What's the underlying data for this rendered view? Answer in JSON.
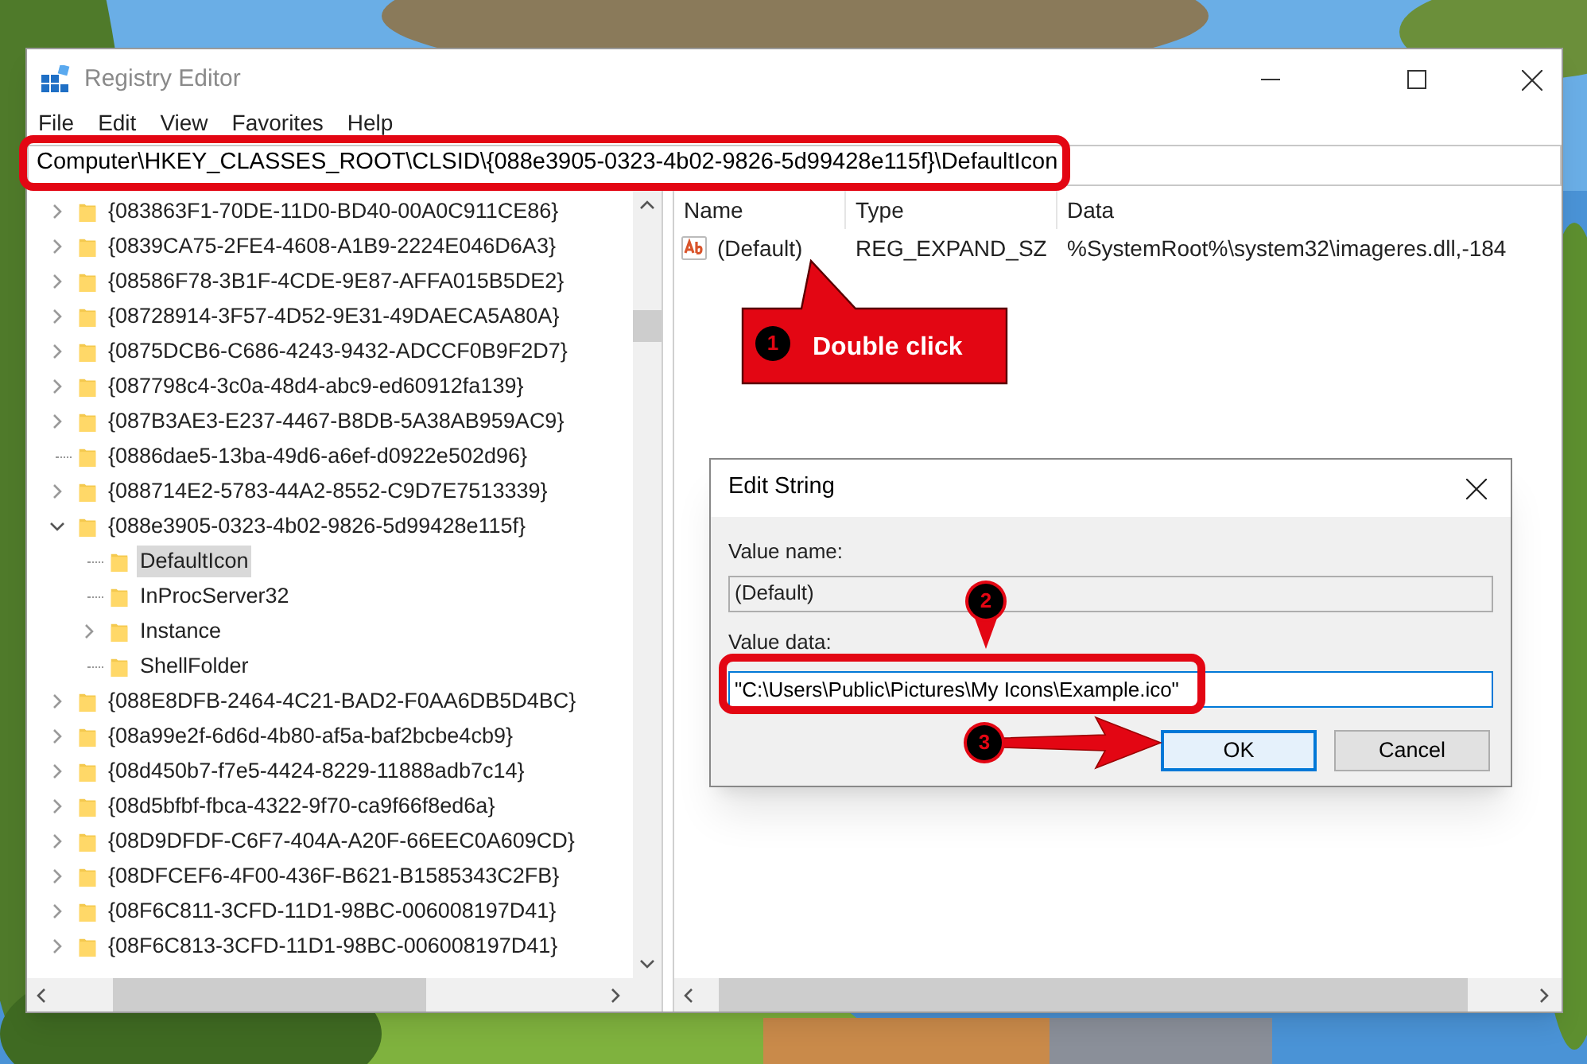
{
  "window": {
    "title": "Registry Editor"
  },
  "menu": [
    "File",
    "Edit",
    "View",
    "Favorites",
    "Help"
  ],
  "address_bar": {
    "value": "Computer\\HKEY_CLASSES_ROOT\\CLSID\\{088e3905-0323-4b02-9826-5d99428e115f}\\DefaultIcon",
    "highlighted": true
  },
  "tree": [
    {
      "label": "{083863F1-70DE-11D0-BD40-00A0C911CE86}",
      "kind": "collapsed",
      "selected": false
    },
    {
      "label": "{0839CA75-2FE4-4608-A1B9-2224E046D6A3}",
      "kind": "collapsed",
      "selected": false
    },
    {
      "label": "{08586F78-3B1F-4CDE-9E87-AFFA015B5DE2}",
      "kind": "collapsed",
      "selected": false
    },
    {
      "label": "{08728914-3F57-4D52-9E31-49DAECA5A80A}",
      "kind": "collapsed",
      "selected": false
    },
    {
      "label": "{0875DCB6-C686-4243-9432-ADCCF0B9F2D7}",
      "kind": "collapsed",
      "selected": false
    },
    {
      "label": "{087798c4-3c0a-48d4-abc9-ed60912fa139}",
      "kind": "collapsed",
      "selected": false
    },
    {
      "label": "{087B3AE3-E237-4467-B8DB-5A38AB959AC9}",
      "kind": "collapsed",
      "selected": false
    },
    {
      "label": "{0886dae5-13ba-49d6-a6ef-d0922e502d96}",
      "kind": "leaf",
      "selected": false
    },
    {
      "label": "{088714E2-5783-44A2-8552-C9D7E7513339}",
      "kind": "collapsed",
      "selected": false
    },
    {
      "label": "{088e3905-0323-4b02-9826-5d99428e115f}",
      "kind": "expanded",
      "selected": false,
      "children": [
        {
          "label": "DefaultIcon",
          "kind": "leaf",
          "selected": true
        },
        {
          "label": "InProcServer32",
          "kind": "leaf",
          "selected": false
        },
        {
          "label": "Instance",
          "kind": "collapsed",
          "selected": false
        },
        {
          "label": "ShellFolder",
          "kind": "leaf",
          "selected": false
        }
      ]
    },
    {
      "label": "{088E8DFB-2464-4C21-BAD2-F0AA6DB5D4BC}",
      "kind": "collapsed",
      "selected": false
    },
    {
      "label": "{08a99e2f-6d6d-4b80-af5a-baf2bcbe4cb9}",
      "kind": "collapsed",
      "selected": false
    },
    {
      "label": "{08d450b7-f7e5-4424-8229-11888adb7c14}",
      "kind": "collapsed",
      "selected": false
    },
    {
      "label": "{08d5bfbf-fbca-4322-9f70-ca9f66f8ed6a}",
      "kind": "collapsed",
      "selected": false
    },
    {
      "label": "{08D9DFDF-C6F7-404A-A20F-66EEC0A609CD}",
      "kind": "collapsed",
      "selected": false
    },
    {
      "label": "{08DFCEF6-4F00-436F-B621-B1585343C2FB}",
      "kind": "collapsed",
      "selected": false
    },
    {
      "label": "{08F6C811-3CFD-11D1-98BC-006008197D41}",
      "kind": "collapsed",
      "selected": false
    },
    {
      "label": "{08F6C813-3CFD-11D1-98BC-006008197D41}",
      "kind": "collapsed",
      "selected": false
    }
  ],
  "values": {
    "columns": [
      "Name",
      "Type",
      "Data"
    ],
    "rows": [
      {
        "name": "(Default)",
        "type": "REG_EXPAND_SZ",
        "data": "%SystemRoot%\\system32\\imageres.dll,-184",
        "selected": false
      }
    ]
  },
  "dialog": {
    "title": "Edit String",
    "value_name": {
      "label": "Value name:",
      "value": "(Default)"
    },
    "value_data": {
      "label": "Value data:",
      "value": "\"C:\\Users\\Public\\Pictures\\My Icons\\Example.ico\"",
      "highlighted": true
    },
    "buttons": [
      {
        "label": "OK",
        "default": true
      },
      {
        "label": "Cancel",
        "default": false
      }
    ]
  },
  "annotations": [
    {
      "kind": "callout",
      "number": "1",
      "text": "Double click"
    },
    {
      "kind": "pin",
      "number": "2"
    },
    {
      "kind": "arrow",
      "number": "3"
    }
  ]
}
